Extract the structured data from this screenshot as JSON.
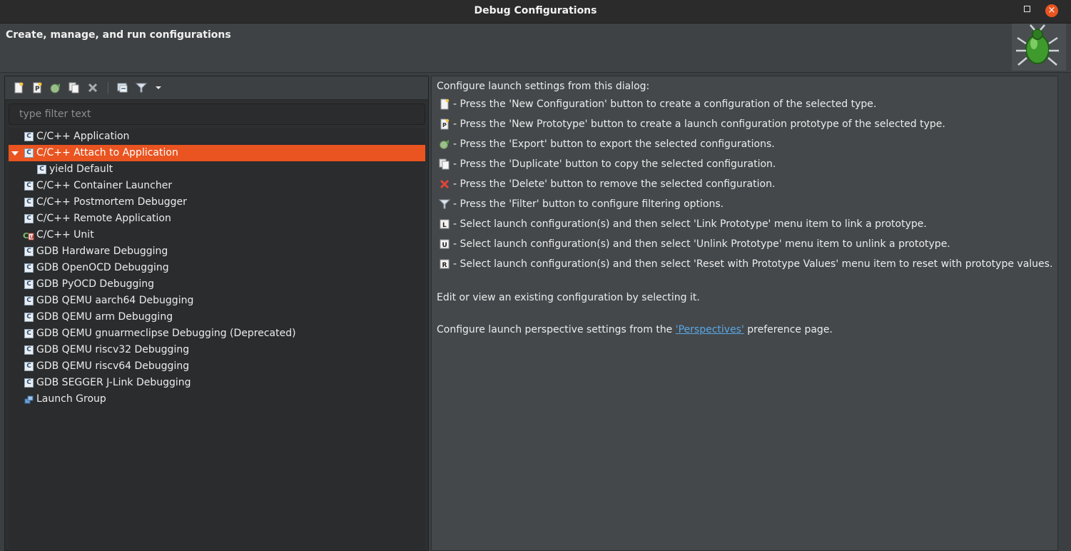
{
  "window": {
    "title": "Debug Configurations",
    "maximize_icon": "maximize-icon",
    "close_icon": "close-icon",
    "close_glyph": "×"
  },
  "header": {
    "heading": "Create, manage, and run configurations",
    "banner_icon": "debug-bug-icon"
  },
  "toolbar": {
    "buttons": [
      {
        "name": "new-configuration-button",
        "icon": "new-configuration-icon"
      },
      {
        "name": "new-prototype-button",
        "icon": "new-prototype-icon"
      },
      {
        "name": "export-button",
        "icon": "export-icon"
      },
      {
        "name": "duplicate-button",
        "icon": "duplicate-icon"
      },
      {
        "name": "delete-button",
        "icon": "delete-icon"
      },
      {
        "name": "collapse-all-button",
        "icon": "collapse-all-icon"
      },
      {
        "name": "filter-button",
        "icon": "filter-icon"
      },
      {
        "name": "view-menu-button",
        "icon": "chevron-down-icon"
      }
    ]
  },
  "filter": {
    "placeholder": "type filter text",
    "value": ""
  },
  "tree": {
    "items": [
      {
        "label": "C/C++ Application",
        "icon": "c-config-icon"
      },
      {
        "label": "C/C++ Attach to Application",
        "icon": "c-config-icon",
        "selected": true,
        "expanded": true
      },
      {
        "label": "yield Default",
        "icon": "c-config-icon",
        "child": true
      },
      {
        "label": "C/C++ Container Launcher",
        "icon": "c-config-icon"
      },
      {
        "label": "C/C++ Postmortem Debugger",
        "icon": "c-config-icon"
      },
      {
        "label": "C/C++ Remote Application",
        "icon": "c-config-icon"
      },
      {
        "label": "C/C++ Unit",
        "icon": "c-unit-icon"
      },
      {
        "label": "GDB Hardware Debugging",
        "icon": "c-config-icon"
      },
      {
        "label": "GDB OpenOCD Debugging",
        "icon": "c-config-icon"
      },
      {
        "label": "GDB PyOCD Debugging",
        "icon": "c-config-icon"
      },
      {
        "label": "GDB QEMU aarch64 Debugging",
        "icon": "c-config-icon"
      },
      {
        "label": "GDB QEMU arm Debugging",
        "icon": "c-config-icon"
      },
      {
        "label": "GDB QEMU gnuarmeclipse Debugging (Deprecated)",
        "icon": "c-config-icon"
      },
      {
        "label": "GDB QEMU riscv32 Debugging",
        "icon": "c-config-icon"
      },
      {
        "label": "GDB QEMU riscv64 Debugging",
        "icon": "c-config-icon"
      },
      {
        "label": "GDB SEGGER J-Link Debugging",
        "icon": "c-config-icon"
      },
      {
        "label": "Launch Group",
        "icon": "launch-group-icon"
      }
    ]
  },
  "help": {
    "intro": "Configure launch settings from this dialog:",
    "rows": [
      {
        "icon": "new-configuration-icon",
        "text": "- Press the 'New Configuration' button to create a configuration of the selected type."
      },
      {
        "icon": "new-prototype-icon",
        "text": "- Press the 'New Prototype' button to create a launch configuration prototype of the selected type."
      },
      {
        "icon": "export-icon",
        "text": "- Press the 'Export' button to export the selected configurations."
      },
      {
        "icon": "duplicate-icon",
        "text": "- Press the 'Duplicate' button to copy the selected configuration."
      },
      {
        "icon": "delete-icon",
        "text": "- Press the 'Delete' button to remove the selected configuration."
      },
      {
        "icon": "filter-icon",
        "text": "- Press the 'Filter' button to configure filtering options."
      },
      {
        "icon": "link-prototype-icon",
        "text": "- Select launch configuration(s) and then select 'Link Prototype' menu item to link a prototype."
      },
      {
        "icon": "unlink-prototype-icon",
        "text": "- Select launch configuration(s) and then select 'Unlink Prototype' menu item to unlink a prototype."
      },
      {
        "icon": "reset-prototype-icon",
        "text": "- Select launch configuration(s) and then select 'Reset with Prototype Values' menu item to reset with prototype values."
      }
    ],
    "edit_text": "Edit or view an existing configuration by selecting it.",
    "perspective_before": "Configure launch perspective settings from the ",
    "perspective_link": "'Perspectives'",
    "perspective_after": " preference page."
  },
  "colors": {
    "selection": "#e95420",
    "link": "#5aa7e6",
    "close_button": "#e95420"
  }
}
